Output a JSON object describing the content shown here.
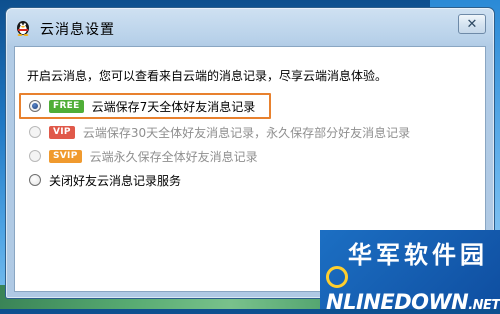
{
  "window": {
    "title": "云消息设置",
    "close_symbol": "✕"
  },
  "content": {
    "intro": "开启云消息，您可以查看来自云端的消息记录，尽享云端消息体验。",
    "options": [
      {
        "badge": "FREE",
        "badge_color": "#4fae37",
        "label": "云端保存7天全体好友消息记录",
        "checked": true,
        "enabled": true
      },
      {
        "badge": "VIP",
        "badge_color": "#e0594a",
        "label": "云端保存30天全体好友消息记录，永久保存部分好友消息记录",
        "checked": false,
        "enabled": false
      },
      {
        "badge": "SVIP",
        "badge_color": "#f09a2e",
        "label": "云端永久保存全体好友消息记录",
        "checked": false,
        "enabled": false
      },
      {
        "badge": "",
        "badge_color": "",
        "label": "关闭好友云消息记录服务",
        "checked": false,
        "enabled": true
      }
    ]
  },
  "watermark": {
    "cn": "华军软件园",
    "en_rest": "NLINEDOWN",
    "en_suffix": ".NET"
  },
  "colors": {
    "highlight": "#e8812e",
    "accent": "#1f78c4"
  },
  "icons": {
    "title_icon": "qq-penguin-icon"
  }
}
